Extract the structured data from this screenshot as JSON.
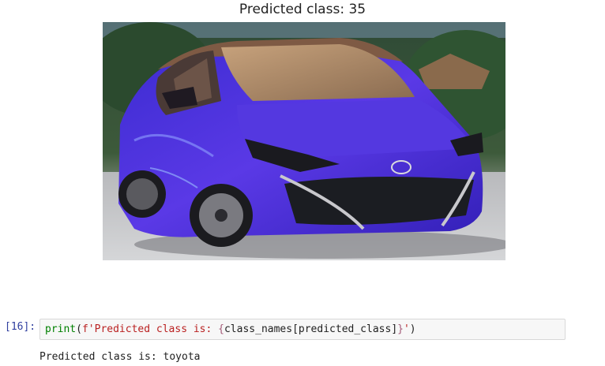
{
  "output_figure": {
    "title": "Predicted class: 35"
  },
  "code_cell": {
    "prompt": "[16]:",
    "code_print": "print",
    "code_open": "(",
    "code_string_start": "f'Predicted class is: ",
    "code_interp_open": "{",
    "code_var_a": "class_names",
    "code_bracket_open": "[",
    "code_var_b": "predicted_class",
    "code_bracket_close": "]",
    "code_interp_close": "}",
    "code_string_end": "'",
    "code_close": ")",
    "output_text": "Predicted class is: toyota"
  },
  "colors": {
    "car_body": "#4a2fd6",
    "prompt": "#303f9f",
    "builtin": "#008000",
    "string": "#ba2121"
  }
}
